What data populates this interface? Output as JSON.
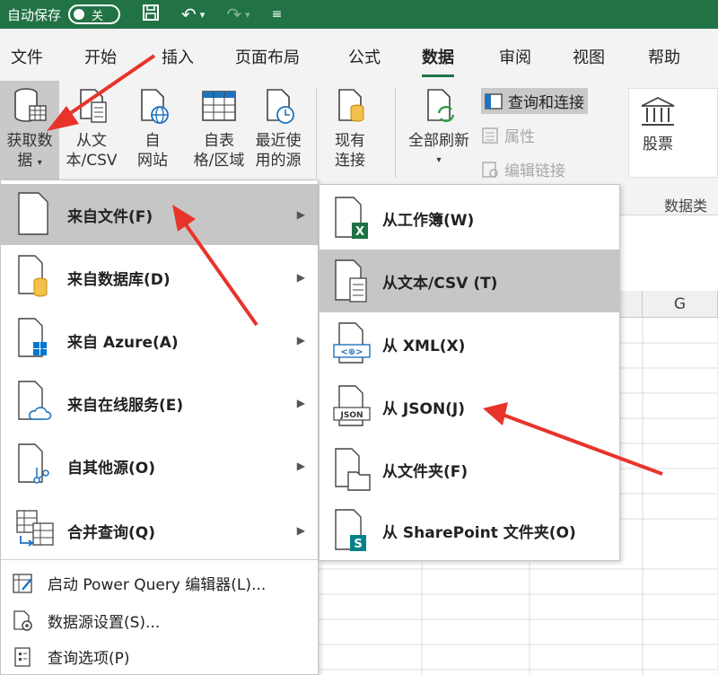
{
  "titlebar": {
    "autosave_label": "自动保存",
    "toggle_state": "关"
  },
  "tabs": [
    "文件",
    "开始",
    "插入",
    "页面布局",
    "公式",
    "数据",
    "审阅",
    "视图",
    "帮助"
  ],
  "active_tab": "数据",
  "ribbon": {
    "get_data": {
      "line1": "获取数",
      "line2": "据"
    },
    "from_text_csv": {
      "line1": "从文",
      "line2": "本/CSV"
    },
    "from_web": {
      "line1": "自",
      "line2": "网站"
    },
    "from_table": {
      "line1": "自表",
      "line2": "格/区域"
    },
    "recent_sources": {
      "line1": "最近使",
      "line2": "用的源"
    },
    "existing_connections": {
      "line1": "现有",
      "line2": "连接"
    },
    "refresh_all": {
      "label": "全部刷新"
    },
    "queries_connections": "查询和连接",
    "properties": "属性",
    "edit_links": "编辑链接",
    "stocks": "股票",
    "data_types_group": "数据类"
  },
  "sheet": {
    "column_g": "G"
  },
  "menu_get_data": {
    "items": [
      {
        "label": "来自文件(F)",
        "has_submenu": true
      },
      {
        "label": "来自数据库(D)",
        "has_submenu": true
      },
      {
        "label": "来自 Azure(A)",
        "has_submenu": true
      },
      {
        "label": "来自在线服务(E)",
        "has_submenu": true
      },
      {
        "label": "自其他源(O)",
        "has_submenu": true
      },
      {
        "label": "合并查询(Q)",
        "has_submenu": true
      }
    ],
    "bottom_items": [
      {
        "label": "启动 Power Query 编辑器(L)..."
      },
      {
        "label": "数据源设置(S)..."
      },
      {
        "label": "查询选项(P)"
      }
    ]
  },
  "menu_from_file": {
    "items": [
      {
        "label": "从工作簿(W)"
      },
      {
        "label": "从文本/CSV (T)"
      },
      {
        "label": "从 XML(X)"
      },
      {
        "label": "从 JSON(J)"
      },
      {
        "label": "从文件夹(F)"
      },
      {
        "label": "从 SharePoint 文件夹(O)"
      }
    ]
  },
  "colors": {
    "excel_green": "#217346",
    "highlight": "#c6c6c6",
    "annotation_red": "#e8332b"
  }
}
